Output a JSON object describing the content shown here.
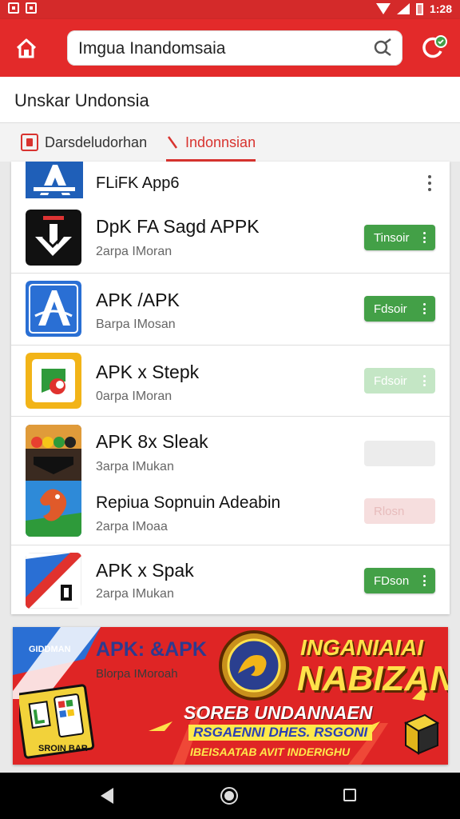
{
  "status_bar": {
    "time": "1:28"
  },
  "header": {
    "search_text": "Imgua Inandomsaia"
  },
  "page_title": "Unskar Undonsia",
  "tabs": [
    {
      "label": "Darsdeludorhan"
    },
    {
      "label": "Indonnsian"
    }
  ],
  "list": {
    "top_item": {
      "title": "FLiFK App6"
    },
    "apps": [
      {
        "name": "DpK FA Sagd APPK",
        "sub": "2arpa IMoran",
        "button": "Tinsoir"
      },
      {
        "name": "APK /APK",
        "sub": "Barpa IMosan",
        "button": "Fdsoir"
      },
      {
        "name": "APK x Stepk",
        "sub": "0arpa IMoran",
        "button": "Fdsoir"
      },
      {
        "name": "APK 8x Sleak",
        "sub": "3arpa IMukan",
        "button": ""
      },
      {
        "name": "Repiua Sopnuin Adeabin",
        "sub": "2arpa IMoaa",
        "button": "Rlosn"
      },
      {
        "name": "APK x Spak",
        "sub": "2arpa IMukan",
        "button": "FDson"
      }
    ]
  },
  "banner": {
    "badge": "GIDDMAN",
    "title": "APK: &APK",
    "sub": "Blorpa IMoroah",
    "big_line1": "INGANIAIAI",
    "big_line2": "NABIZAN",
    "line1": "SOREB UNDANNAEN",
    "line2": "RSGAENNI DHES. RSGONI",
    "line3": "IBEISAATAB AVIT INDERIGHU",
    "sign": "SROIN BAR"
  },
  "colors": {
    "brand_red": "#e32a2a",
    "install_green": "#43a047",
    "tab_active": "#d8332f"
  },
  "icons": {
    "home": "home-icon",
    "search": "search-icon",
    "refresh": "refresh-icon",
    "more": "kebab-icon"
  }
}
